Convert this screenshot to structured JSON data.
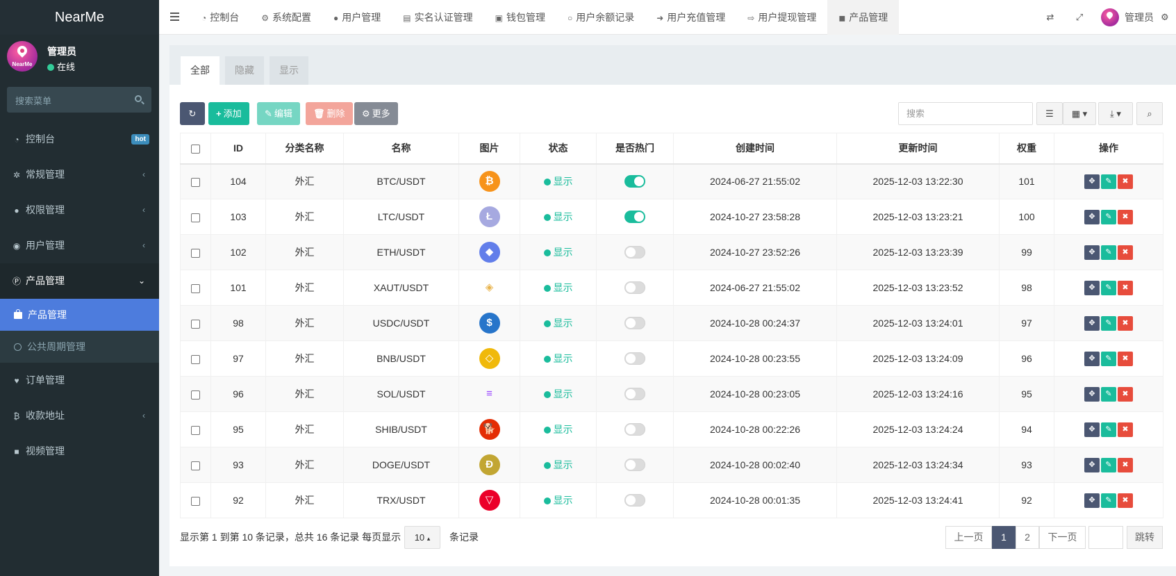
{
  "app": {
    "logo": "NearMe",
    "avatar_brand": "NearMe"
  },
  "user": {
    "name": "管理员",
    "status": "在线"
  },
  "sidebar": {
    "search_placeholder": "搜索菜单",
    "items": [
      {
        "label": "控制台",
        "icon": "dashboard-icon",
        "badge": "hot"
      },
      {
        "label": "常规管理",
        "icon": "cogs-icon"
      },
      {
        "label": "权限管理",
        "icon": "group-icon"
      },
      {
        "label": "用户管理",
        "icon": "user-circle-icon"
      },
      {
        "label": "产品管理",
        "icon": "product-icon",
        "open": true
      },
      {
        "label": "订单管理",
        "icon": "heartbeat-icon"
      },
      {
        "label": "收款地址",
        "icon": "bitcoin-icon"
      },
      {
        "label": "视频管理",
        "icon": "video-icon"
      }
    ],
    "submenu": [
      {
        "label": "产品管理",
        "active": true
      },
      {
        "label": "公共周期管理"
      }
    ]
  },
  "topnav": {
    "tabs": [
      {
        "label": "控制台",
        "icon": "dashboard-icon"
      },
      {
        "label": "系统配置",
        "icon": "cog-icon"
      },
      {
        "label": "用户管理",
        "icon": "user-icon"
      },
      {
        "label": "实名认证管理",
        "icon": "id-card-icon"
      },
      {
        "label": "钱包管理",
        "icon": "money-icon"
      },
      {
        "label": "用户余额记录",
        "icon": "circle-icon"
      },
      {
        "label": "用户充值管理",
        "icon": "sign-in-icon"
      },
      {
        "label": "用户提现管理",
        "icon": "sign-out-icon"
      },
      {
        "label": "产品管理",
        "icon": "shopping-bag-icon",
        "active": true
      }
    ],
    "admin_label": "管理员"
  },
  "panel": {
    "tabs": [
      "全部",
      "隐藏",
      "显示"
    ],
    "toolbar": {
      "refresh": "",
      "add": "添加",
      "edit": "编辑",
      "delete": "删除",
      "more": "更多",
      "search_placeholder": "搜索"
    }
  },
  "table": {
    "headers": [
      "ID",
      "分类名称",
      "名称",
      "图片",
      "状态",
      "是否热门",
      "创建时间",
      "更新时间",
      "权重",
      "操作"
    ],
    "rows": [
      {
        "id": "104",
        "category": "外汇",
        "name": "BTC/USDT",
        "coin": "btc",
        "status": "显示",
        "hot": true,
        "created": "2024-06-27 21:55:02",
        "updated": "2025-12-03 13:22:30",
        "weight": "101"
      },
      {
        "id": "103",
        "category": "外汇",
        "name": "LTC/USDT",
        "coin": "ltc",
        "status": "显示",
        "hot": true,
        "created": "2024-10-27 23:58:28",
        "updated": "2025-12-03 13:23:21",
        "weight": "100"
      },
      {
        "id": "102",
        "category": "外汇",
        "name": "ETH/USDT",
        "coin": "eth",
        "status": "显示",
        "hot": false,
        "created": "2024-10-27 23:52:26",
        "updated": "2025-12-03 13:23:39",
        "weight": "99"
      },
      {
        "id": "101",
        "category": "外汇",
        "name": "XAUT/USDT",
        "coin": "xaut",
        "status": "显示",
        "hot": false,
        "created": "2024-06-27 21:55:02",
        "updated": "2025-12-03 13:23:52",
        "weight": "98"
      },
      {
        "id": "98",
        "category": "外汇",
        "name": "USDC/USDT",
        "coin": "usdc",
        "status": "显示",
        "hot": false,
        "created": "2024-10-28 00:24:37",
        "updated": "2025-12-03 13:24:01",
        "weight": "97"
      },
      {
        "id": "97",
        "category": "外汇",
        "name": "BNB/USDT",
        "coin": "bnb",
        "status": "显示",
        "hot": false,
        "created": "2024-10-28 00:23:55",
        "updated": "2025-12-03 13:24:09",
        "weight": "96"
      },
      {
        "id": "96",
        "category": "外汇",
        "name": "SOL/USDT",
        "coin": "sol",
        "status": "显示",
        "hot": false,
        "created": "2024-10-28 00:23:05",
        "updated": "2025-12-03 13:24:16",
        "weight": "95"
      },
      {
        "id": "95",
        "category": "外汇",
        "name": "SHIB/USDT",
        "coin": "shib",
        "status": "显示",
        "hot": false,
        "created": "2024-10-28 00:22:26",
        "updated": "2025-12-03 13:24:24",
        "weight": "94"
      },
      {
        "id": "93",
        "category": "外汇",
        "name": "DOGE/USDT",
        "coin": "doge",
        "status": "显示",
        "hot": false,
        "created": "2024-10-28 00:02:40",
        "updated": "2025-12-03 13:24:34",
        "weight": "93"
      },
      {
        "id": "92",
        "category": "外汇",
        "name": "TRX/USDT",
        "coin": "trx",
        "status": "显示",
        "hot": false,
        "created": "2024-10-28 00:01:35",
        "updated": "2025-12-03 13:24:41",
        "weight": "92"
      }
    ]
  },
  "footer": {
    "info": "显示第 1 到第 10 条记录，总共 16 条记录 每页显示",
    "page_size": "10",
    "page_size_suffix": "条记录",
    "prev": "上一页",
    "pages": [
      "1",
      "2"
    ],
    "current_page": "1",
    "next": "下一页",
    "jump": "跳转"
  },
  "colors": {
    "sidebar_bg": "#222d32",
    "active_menu": "#4d7cdd",
    "accent_green": "#1abc9c",
    "accent_dark": "#4b5772",
    "danger": "#e74c3c"
  }
}
